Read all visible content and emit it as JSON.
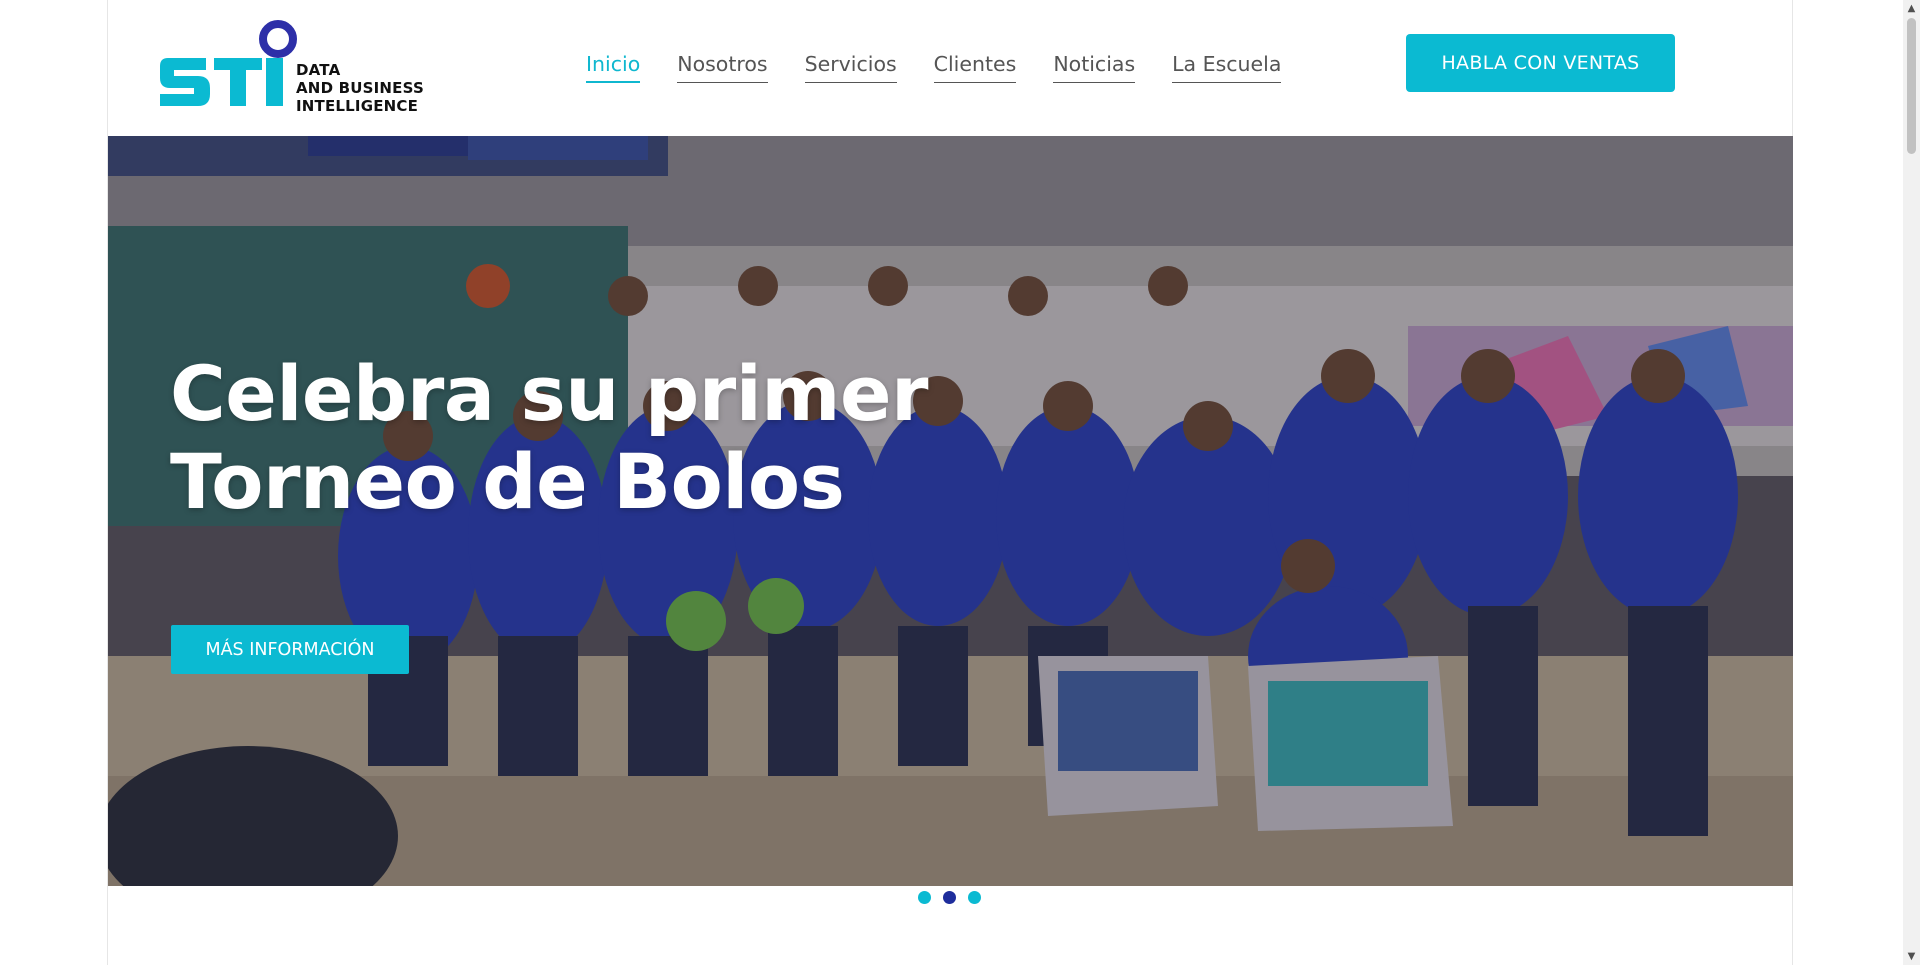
{
  "brand": {
    "logo_letters": "STI",
    "tagline_lines": [
      "DATA",
      "AND BUSINESS",
      "INTELLIGENCE"
    ],
    "primary_color": "#0bbad2",
    "secondary_color": "#2d2fa8"
  },
  "nav": {
    "items": [
      {
        "label": "Inicio",
        "active": true
      },
      {
        "label": "Nosotros",
        "active": false
      },
      {
        "label": "Servicios",
        "active": false
      },
      {
        "label": "Clientes",
        "active": false
      },
      {
        "label": "Noticias",
        "active": false
      },
      {
        "label": "La Escuela",
        "active": false
      }
    ]
  },
  "header": {
    "cta_label": "HABLA CON VENTAS"
  },
  "hero": {
    "title_lines": [
      "Celebra su primer",
      "Torneo de Bolos"
    ],
    "button_label": "MÁS INFORMACIÓN"
  },
  "slider": {
    "total_slides": 3,
    "active_slide": 2
  },
  "scrollbar": {
    "up_icon": "arrow-up-icon",
    "down_icon": "arrow-down-icon"
  }
}
